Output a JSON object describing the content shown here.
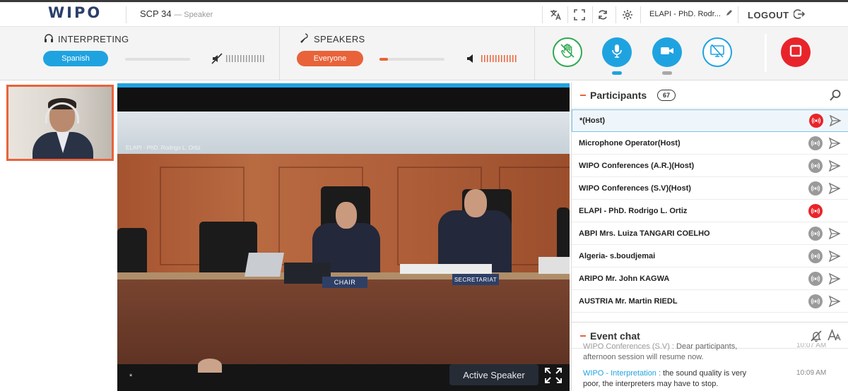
{
  "header": {
    "logo": "WIPO",
    "session_title": "SCP 34",
    "session_role": "— Speaker",
    "user_name": "ELAPI - PhD. Rodr...",
    "logout_label": "LOGOUT"
  },
  "interpreting": {
    "title": "INTERPRETING",
    "language": "Spanish"
  },
  "speakers": {
    "title": "SPEAKERS",
    "selection": "Everyone"
  },
  "colors": {
    "accent_blue": "#1fa3e0",
    "accent_orange": "#e8633a",
    "stop_red": "#e8242a",
    "raise_hand_green": "#2fa84f"
  },
  "main_video": {
    "caption": "ELAPI - PhD. Rodrigo L. Ortiz",
    "chair_label": "CHAIR",
    "secretariat_label": "SECRETARIAT",
    "star": "*",
    "active_speaker_label": "Active Speaker"
  },
  "participants": {
    "title": "Participants",
    "count": "67",
    "rows": [
      {
        "name": "*(Host)",
        "mic": "active",
        "send": true
      },
      {
        "name": "Microphone Operator(Host)",
        "mic": "idle",
        "send": true
      },
      {
        "name": "WIPO Conferences (A.R.)(Host)",
        "mic": "idle",
        "send": true
      },
      {
        "name": "WIPO Conferences (S.V)(Host)",
        "mic": "idle",
        "send": true
      },
      {
        "name": "ELAPI - PhD. Rodrigo L. Ortiz",
        "mic": "active",
        "send": false
      },
      {
        "name": "ABPI Mrs. Luiza TANGARI COELHO",
        "mic": "idle",
        "send": true
      },
      {
        "name": "Algeria- s.boudjemai",
        "mic": "idle",
        "send": true
      },
      {
        "name": "ARIPO Mr. John KAGWA",
        "mic": "idle",
        "send": true
      },
      {
        "name": "AUSTRIA Mr. Martin RIEDL",
        "mic": "idle",
        "send": true
      }
    ]
  },
  "event_chat": {
    "title": "Event chat",
    "messages": [
      {
        "sender": "WIPO Conferences (S.V) :",
        "text": "Dear participants, afternoon session will resume now.",
        "time": "10:07 AM"
      },
      {
        "sender": "WIPO - Interpretation :",
        "text": "the sound quality is very poor, the interpreters may have to stop.",
        "time": "10:09 AM"
      }
    ]
  }
}
